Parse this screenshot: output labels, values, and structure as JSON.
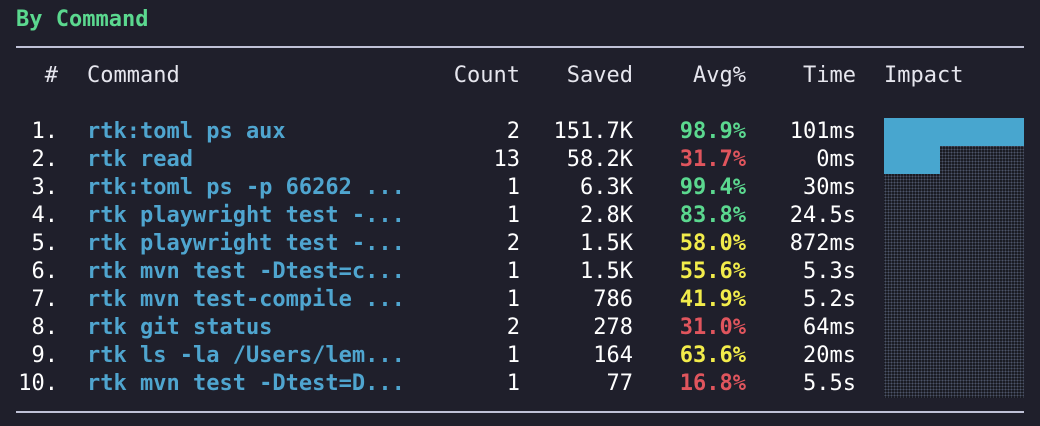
{
  "section_title": "By Command",
  "columns": {
    "num": "#",
    "command": "Command",
    "count": "Count",
    "saved": "Saved",
    "avg": "Avg%",
    "time": "Time",
    "impact": "Impact"
  },
  "colors": {
    "title_green": "#5bd88f",
    "command_blue": "#4fa5cf",
    "good_green": "#5bd88f",
    "mid_yellow": "#f2ec4b",
    "bad_red": "#e0555d",
    "impact_bar": "#48a6cf",
    "background": "#1f1f2b"
  },
  "rows": [
    {
      "num": "1.",
      "command": "rtk:toml ps aux",
      "count": "2",
      "saved": "151.7K",
      "avg": "98.9%",
      "avg_level": "green",
      "time": "101ms",
      "impact": 1.0
    },
    {
      "num": "2.",
      "command": "rtk read",
      "count": "13",
      "saved": "58.2K",
      "avg": "31.7%",
      "avg_level": "red",
      "time": "0ms",
      "impact": 0.4
    },
    {
      "num": "3.",
      "command": "rtk:toml ps -p 66262 ...",
      "count": "1",
      "saved": "6.3K",
      "avg": "99.4%",
      "avg_level": "green",
      "time": "30ms",
      "impact": 0
    },
    {
      "num": "4.",
      "command": "rtk playwright test -...",
      "count": "1",
      "saved": "2.8K",
      "avg": "83.8%",
      "avg_level": "green",
      "time": "24.5s",
      "impact": 0
    },
    {
      "num": "5.",
      "command": "rtk playwright test -...",
      "count": "2",
      "saved": "1.5K",
      "avg": "58.0%",
      "avg_level": "yellow",
      "time": "872ms",
      "impact": 0
    },
    {
      "num": "6.",
      "command": "rtk mvn test -Dtest=c...",
      "count": "1",
      "saved": "1.5K",
      "avg": "55.6%",
      "avg_level": "yellow",
      "time": "5.3s",
      "impact": 0
    },
    {
      "num": "7.",
      "command": "rtk mvn test-compile ...",
      "count": "1",
      "saved": "786",
      "avg": "41.9%",
      "avg_level": "yellow",
      "time": "5.2s",
      "impact": 0
    },
    {
      "num": "8.",
      "command": "rtk git status",
      "count": "2",
      "saved": "278",
      "avg": "31.0%",
      "avg_level": "red",
      "time": "64ms",
      "impact": 0
    },
    {
      "num": "9.",
      "command": "rtk ls -la /Users/lem...",
      "count": "1",
      "saved": "164",
      "avg": "63.6%",
      "avg_level": "yellow",
      "time": "20ms",
      "impact": 0
    },
    {
      "num": "10.",
      "command": "rtk mvn test -Dtest=D...",
      "count": "1",
      "saved": "77",
      "avg": "16.8%",
      "avg_level": "red",
      "time": "5.5s",
      "impact": 0
    }
  ]
}
